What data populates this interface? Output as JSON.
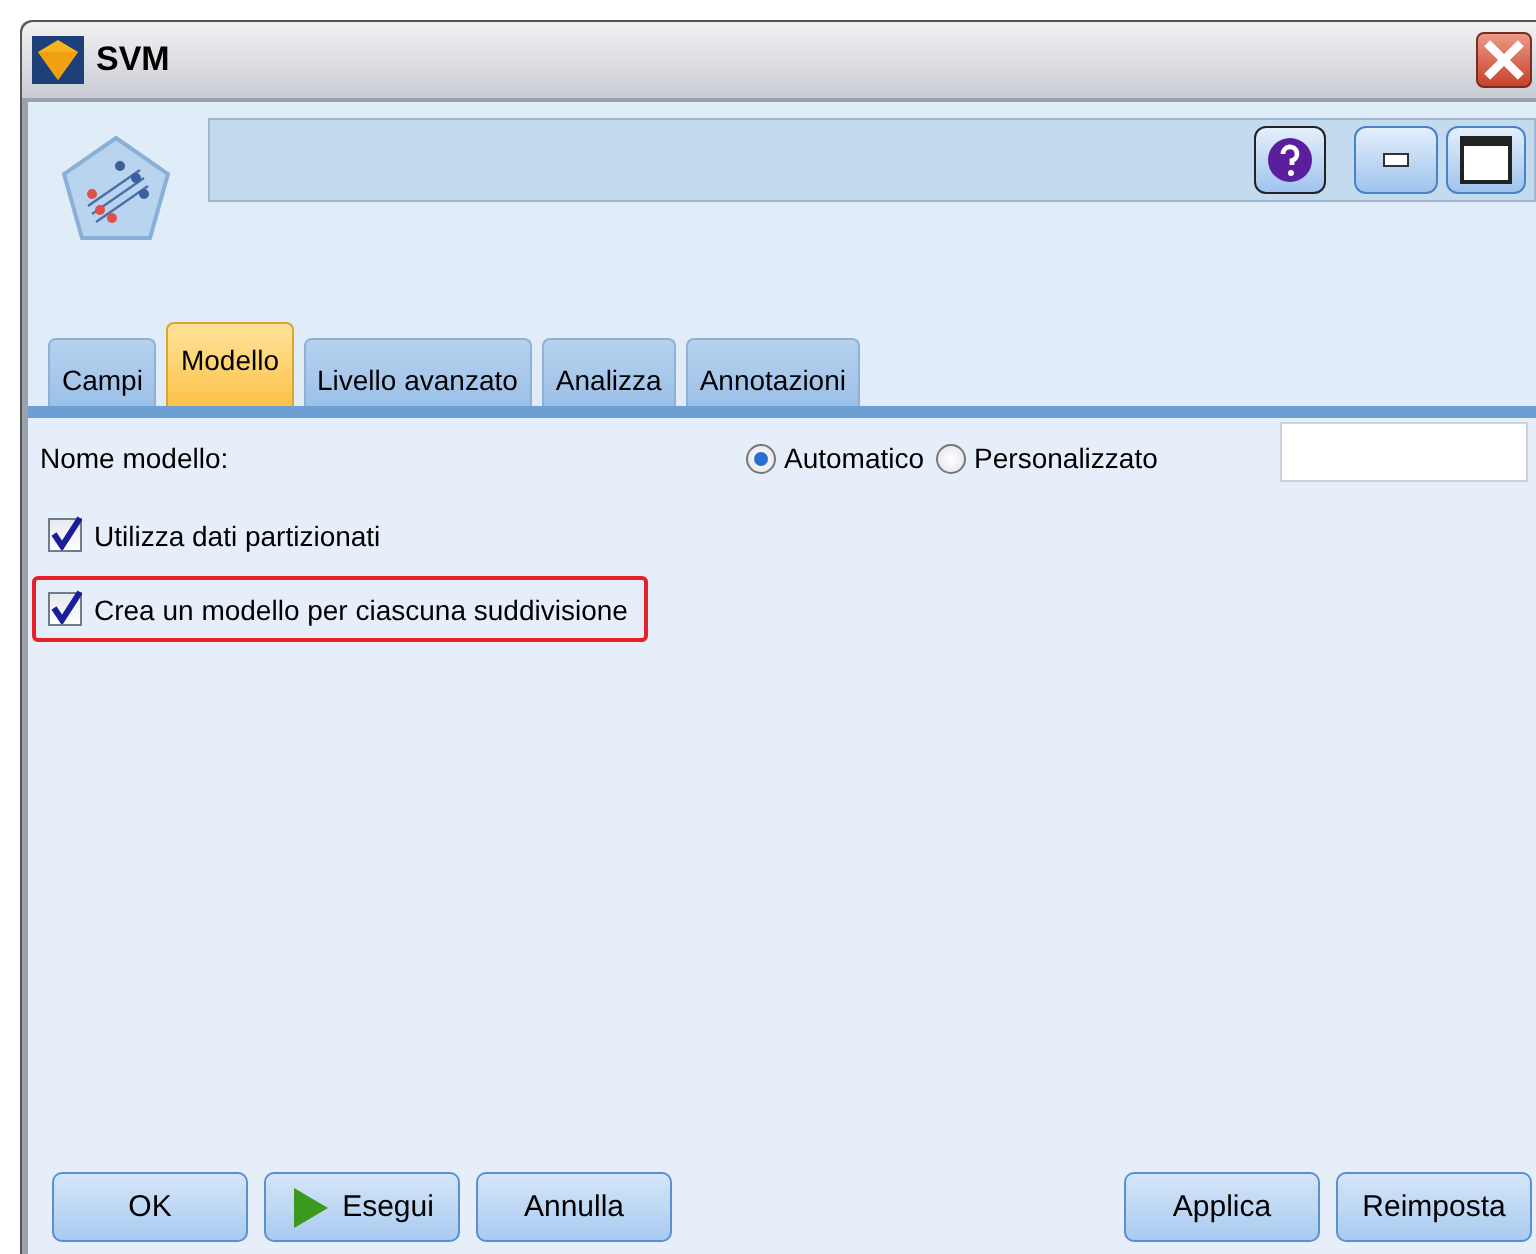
{
  "window": {
    "title": "SVM"
  },
  "tabs": [
    {
      "label": "Campi",
      "selected": false
    },
    {
      "label": "Modello",
      "selected": true
    },
    {
      "label": "Livello avanzato",
      "selected": false
    },
    {
      "label": "Analizza",
      "selected": false
    },
    {
      "label": "Annotazioni",
      "selected": false
    }
  ],
  "model_name": {
    "label": "Nome modello:",
    "options": [
      {
        "label": "Automatico",
        "selected": true
      },
      {
        "label": "Personalizzato",
        "selected": false
      }
    ]
  },
  "checkboxes": [
    {
      "label": "Utilizza dati partizionati",
      "checked": true,
      "highlighted": false
    },
    {
      "label": "Crea un modello per ciascuna suddivisione",
      "checked": true,
      "highlighted": true
    }
  ],
  "buttons_left": [
    {
      "label": "OK",
      "kind": "plain"
    },
    {
      "label": "Esegui",
      "kind": "run"
    },
    {
      "label": "Annulla",
      "kind": "plain"
    }
  ],
  "buttons_right": [
    {
      "label": "Applica",
      "kind": "plain"
    },
    {
      "label": "Reimposta",
      "kind": "plain"
    }
  ]
}
